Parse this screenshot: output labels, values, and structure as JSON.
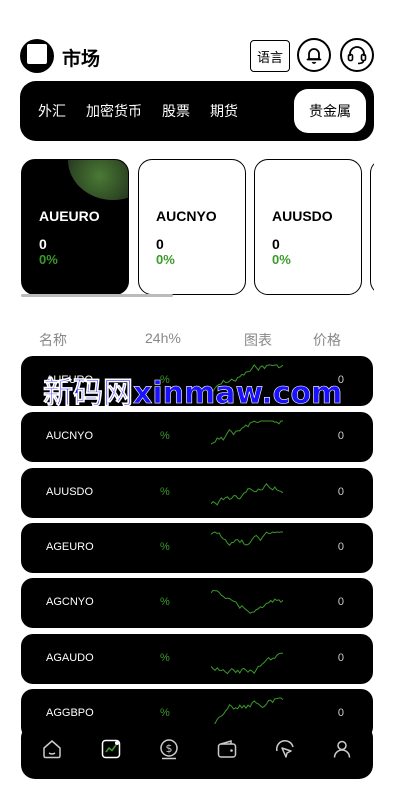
{
  "header": {
    "title": "市场",
    "language_label": "语言",
    "icons": [
      "logo-icon",
      "bell-icon",
      "headset-icon"
    ]
  },
  "tabs": [
    {
      "label": "外汇",
      "active": false
    },
    {
      "label": "加密货币",
      "active": false
    },
    {
      "label": "股票",
      "active": false
    },
    {
      "label": "期货",
      "active": false
    },
    {
      "label": "贵金属",
      "active": true
    }
  ],
  "cards": [
    {
      "name": "AUEURO",
      "price": "0",
      "change": "0%"
    },
    {
      "name": "AUCNYO",
      "price": "0",
      "change": "0%"
    },
    {
      "name": "AUUSDO",
      "price": "0",
      "change": "0%"
    }
  ],
  "list_header": {
    "name": "名称",
    "change": "24h%",
    "chart": "图表",
    "price": "价格"
  },
  "rows": [
    {
      "name": "AUEURO",
      "change": "%",
      "price": "0"
    },
    {
      "name": "AUCNYO",
      "change": "%",
      "price": "0"
    },
    {
      "name": "AUUSDO",
      "change": "%",
      "price": "0"
    },
    {
      "name": "AGEURO",
      "change": "%",
      "price": "0"
    },
    {
      "name": "AGCNYO",
      "change": "%",
      "price": "0"
    },
    {
      "name": "AGAUDO",
      "change": "%",
      "price": "0"
    },
    {
      "name": "AGGBPO",
      "change": "%",
      "price": "0"
    }
  ],
  "watermark": "新码网xinmaw.com",
  "bottom_nav": [
    "home-icon",
    "market-icon",
    "dollar-icon",
    "wallet-icon",
    "trade-icon",
    "profile-icon"
  ],
  "colors": {
    "accent_green": "#3a9a2a",
    "background": "#000000",
    "watermark": "#1a12ff"
  }
}
